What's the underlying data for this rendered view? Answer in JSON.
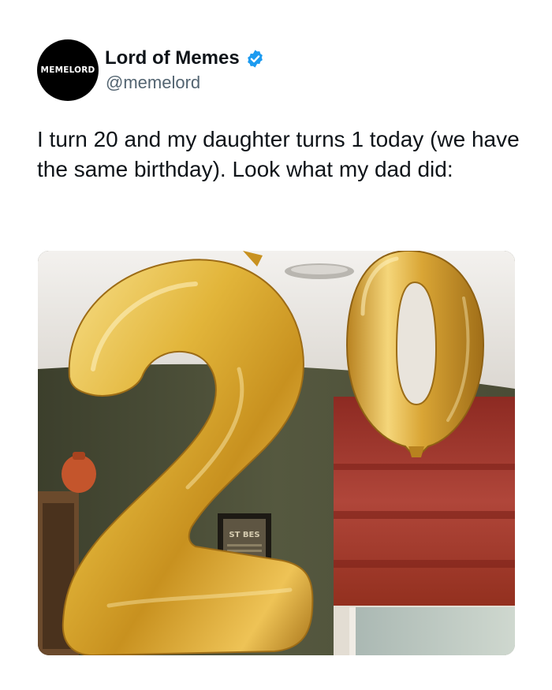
{
  "author": {
    "avatar_text": "MEMELORD",
    "display_name": "Lord of Memes",
    "handle": "@memelord",
    "verified": true,
    "verified_icon": "verified-badge-icon",
    "verified_color": "#1d9bf0"
  },
  "tweet": {
    "text": "I turn 20 and my daughter turns 1 today (we have the same birthday). Look what my dad did:"
  },
  "media": {
    "type": "photo",
    "balloon_digits": [
      "2",
      "0"
    ],
    "poster_text": "ST BES"
  },
  "colors": {
    "text": "#0f1419",
    "secondary_text": "#536471",
    "avatar_bg": "#000000",
    "balloon_gold": "#e2b53a"
  }
}
